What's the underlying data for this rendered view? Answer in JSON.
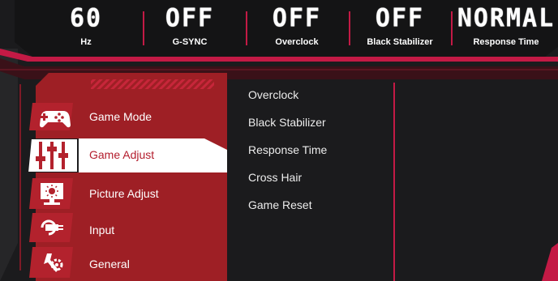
{
  "status_bar": [
    {
      "value": "60",
      "label": "Hz"
    },
    {
      "value": "OFF",
      "label": "G-SYNC"
    },
    {
      "value": "OFF",
      "label": "Overclock"
    },
    {
      "value": "OFF",
      "label": "Black Stabilizer"
    },
    {
      "value": "NORMAL",
      "label": "Response Time"
    }
  ],
  "main_menu": [
    {
      "label": "Game Mode",
      "icon": "gamepad-icon",
      "selected": false
    },
    {
      "label": "Game Adjust",
      "icon": "sliders-icon",
      "selected": true
    },
    {
      "label": "Picture Adjust",
      "icon": "monitor-brightness-icon",
      "selected": false
    },
    {
      "label": "Input",
      "icon": "input-plug-icon",
      "selected": false
    },
    {
      "label": "General",
      "icon": "general-settings-icon",
      "selected": false
    }
  ],
  "submenu": [
    {
      "label": "Overclock"
    },
    {
      "label": "Black Stabilizer"
    },
    {
      "label": "Response Time"
    },
    {
      "label": "Cross Hair"
    },
    {
      "label": "Game Reset"
    }
  ],
  "colors": {
    "accent": "#c31a45",
    "panel_red": "#9e1f25",
    "background": "#1b1b1d",
    "selected_bg": "#ffffff",
    "selected_text": "#b31c2c"
  }
}
